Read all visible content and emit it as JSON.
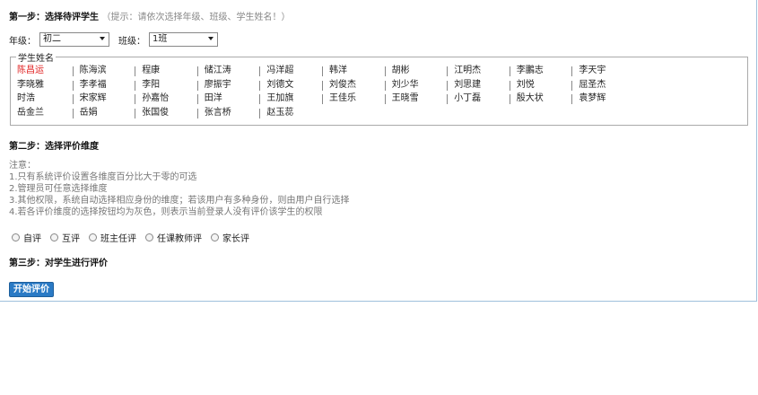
{
  "step1": {
    "title": "第一步：选择待评学生",
    "hint": "（提示：请依次选择年级、班级、学生姓名！）"
  },
  "grade": {
    "label": "年级：",
    "value": "初二"
  },
  "class": {
    "label": "班级：",
    "value": "1班"
  },
  "students_legend": "学生姓名",
  "students": [
    "陈昌运",
    "陈海滨",
    "程康",
    "储江涛",
    "冯洋超",
    "韩洋",
    "胡彬",
    "江明杰",
    "李鵬志",
    "李天宇",
    "李晓雅",
    "李孝福",
    "李阳",
    "廖振宇",
    "刘德文",
    "刘俊杰",
    "刘少华",
    "刘思建",
    "刘悦",
    "屈圣杰",
    "时浩",
    "宋家辉",
    "孙嘉怡",
    "田洋",
    "王加旗",
    "王佳乐",
    "王晓雪",
    "小丁磊",
    "殷大状",
    "袁梦辉",
    "岳金兰",
    "岳娟",
    "张国俊",
    "张言桥",
    "赵玉蕊"
  ],
  "selected_student": "陈昌运",
  "step2": {
    "title": "第二步：选择评价维度"
  },
  "notes": {
    "heading": "注意：",
    "line1": "1.只有系统评价设置各维度百分比大于零的可选",
    "line2": "2.管理员可任意选择维度",
    "line3": "3.其他权限，系统自动选择相应身份的维度；若该用户有多种身份，则由用户自行选择",
    "line4": "4.若各评价维度的选择按钮均为灰色，则表示当前登录人没有评价该学生的权限"
  },
  "dimensions": [
    "自评",
    "互评",
    "班主任评",
    "任课教师评",
    "家长评"
  ],
  "step3": {
    "title": "第三步：对学生进行评价"
  },
  "start_button": "开始评价",
  "colors": {
    "selected": "#e02020",
    "button": "#2a7ac5",
    "frame_border": "#9fc0dc"
  }
}
